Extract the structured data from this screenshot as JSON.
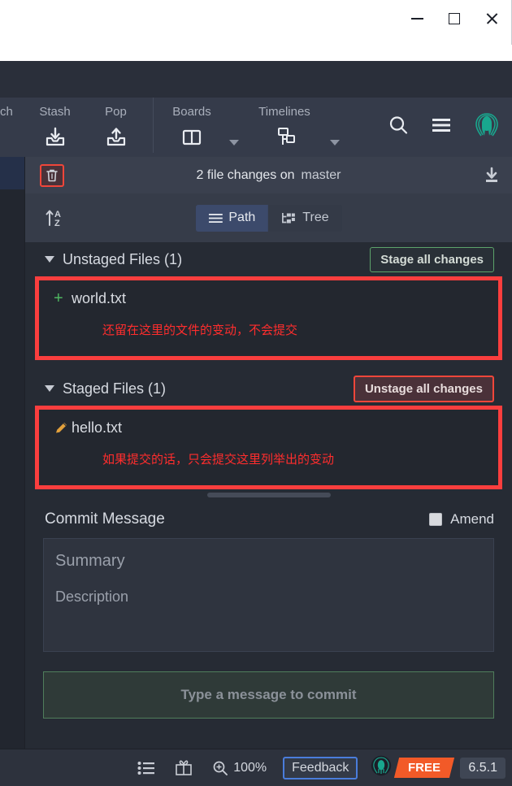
{
  "window": {
    "controls": [
      {
        "name": "minimize",
        "glyph": "minimize-icon"
      },
      {
        "name": "maximize",
        "glyph": "maximize-icon"
      },
      {
        "name": "close",
        "glyph": "close-icon"
      }
    ]
  },
  "toolbar": {
    "truncated_left_label": "ch",
    "items": [
      {
        "label": "Stash",
        "icon": "stash-down-icon"
      },
      {
        "label": "Pop",
        "icon": "stash-up-icon"
      },
      {
        "label": "Boards",
        "icon": "boards-icon",
        "has_caret": true
      },
      {
        "label": "Timelines",
        "icon": "timelines-icon",
        "has_caret": true
      }
    ],
    "right_icons": [
      {
        "name": "search-icon"
      },
      {
        "name": "hamburger-menu-icon"
      },
      {
        "name": "gitkraken-logo-icon"
      }
    ]
  },
  "panel": {
    "header": {
      "trash_icon": "trash-icon",
      "title": "2 file changes on",
      "branch": "master",
      "download_icon": "download-icon"
    },
    "sort": {
      "icon": "sort-az-icon"
    },
    "view_toggle": {
      "options": [
        {
          "label": "Path",
          "icon": "list-icon",
          "active": true
        },
        {
          "label": "Tree",
          "icon": "tree-icon",
          "active": false
        }
      ]
    },
    "unstaged": {
      "title": "Unstaged Files (1)",
      "action_label": "Stage all changes",
      "files": [
        {
          "name": "world.txt",
          "status_icon": "plus-icon",
          "status_color": "#4eb560",
          "annotation": "还留在这里的文件的变动，不会提交"
        }
      ]
    },
    "staged": {
      "title": "Staged Files (1)",
      "action_label": "Unstage all changes",
      "files": [
        {
          "name": "hello.txt",
          "status_icon": "pencil-icon",
          "status_color": "#e3a13c",
          "annotation": "如果提交的话，只会提交这里列举出的变动"
        }
      ]
    },
    "commit_message": {
      "title": "Commit Message",
      "amend_label": "Amend",
      "amend_checked": false,
      "summary_placeholder": "Summary",
      "description_placeholder": "Description",
      "commit_button_label": "Type a message to commit"
    }
  },
  "statusbar": {
    "items": [
      {
        "name": "list-icon"
      },
      {
        "name": "gift-icon"
      }
    ],
    "zoom_icon": "zoom-in-icon",
    "zoom_level": "100%",
    "feedback_label": "Feedback",
    "kraken_icon": "gitkraken-logo-icon",
    "plan_badge": "FREE",
    "version": "6.5.1"
  },
  "colors": {
    "accent_red": "#fa3e3e",
    "annotation_red": "#ff2d2d",
    "stage_green": "#5ca36a",
    "kraken_teal": "#19a78e",
    "free_orange": "#f25a28",
    "feedback_blue": "#4a7ddb"
  }
}
